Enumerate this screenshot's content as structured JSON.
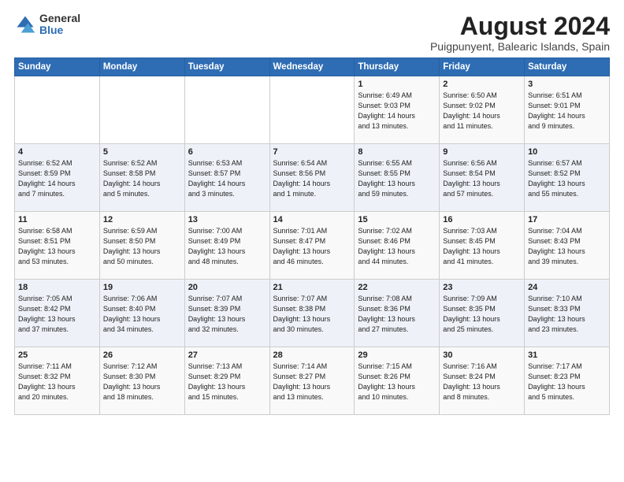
{
  "header": {
    "logo_general": "General",
    "logo_blue": "Blue",
    "title": "August 2024",
    "subtitle": "Puigpunyent, Balearic Islands, Spain"
  },
  "weekdays": [
    "Sunday",
    "Monday",
    "Tuesday",
    "Wednesday",
    "Thursday",
    "Friday",
    "Saturday"
  ],
  "weeks": [
    [
      {
        "day": "",
        "info": ""
      },
      {
        "day": "",
        "info": ""
      },
      {
        "day": "",
        "info": ""
      },
      {
        "day": "",
        "info": ""
      },
      {
        "day": "1",
        "info": "Sunrise: 6:49 AM\nSunset: 9:03 PM\nDaylight: 14 hours\nand 13 minutes."
      },
      {
        "day": "2",
        "info": "Sunrise: 6:50 AM\nSunset: 9:02 PM\nDaylight: 14 hours\nand 11 minutes."
      },
      {
        "day": "3",
        "info": "Sunrise: 6:51 AM\nSunset: 9:01 PM\nDaylight: 14 hours\nand 9 minutes."
      }
    ],
    [
      {
        "day": "4",
        "info": "Sunrise: 6:52 AM\nSunset: 8:59 PM\nDaylight: 14 hours\nand 7 minutes."
      },
      {
        "day": "5",
        "info": "Sunrise: 6:52 AM\nSunset: 8:58 PM\nDaylight: 14 hours\nand 5 minutes."
      },
      {
        "day": "6",
        "info": "Sunrise: 6:53 AM\nSunset: 8:57 PM\nDaylight: 14 hours\nand 3 minutes."
      },
      {
        "day": "7",
        "info": "Sunrise: 6:54 AM\nSunset: 8:56 PM\nDaylight: 14 hours\nand 1 minute."
      },
      {
        "day": "8",
        "info": "Sunrise: 6:55 AM\nSunset: 8:55 PM\nDaylight: 13 hours\nand 59 minutes."
      },
      {
        "day": "9",
        "info": "Sunrise: 6:56 AM\nSunset: 8:54 PM\nDaylight: 13 hours\nand 57 minutes."
      },
      {
        "day": "10",
        "info": "Sunrise: 6:57 AM\nSunset: 8:52 PM\nDaylight: 13 hours\nand 55 minutes."
      }
    ],
    [
      {
        "day": "11",
        "info": "Sunrise: 6:58 AM\nSunset: 8:51 PM\nDaylight: 13 hours\nand 53 minutes."
      },
      {
        "day": "12",
        "info": "Sunrise: 6:59 AM\nSunset: 8:50 PM\nDaylight: 13 hours\nand 50 minutes."
      },
      {
        "day": "13",
        "info": "Sunrise: 7:00 AM\nSunset: 8:49 PM\nDaylight: 13 hours\nand 48 minutes."
      },
      {
        "day": "14",
        "info": "Sunrise: 7:01 AM\nSunset: 8:47 PM\nDaylight: 13 hours\nand 46 minutes."
      },
      {
        "day": "15",
        "info": "Sunrise: 7:02 AM\nSunset: 8:46 PM\nDaylight: 13 hours\nand 44 minutes."
      },
      {
        "day": "16",
        "info": "Sunrise: 7:03 AM\nSunset: 8:45 PM\nDaylight: 13 hours\nand 41 minutes."
      },
      {
        "day": "17",
        "info": "Sunrise: 7:04 AM\nSunset: 8:43 PM\nDaylight: 13 hours\nand 39 minutes."
      }
    ],
    [
      {
        "day": "18",
        "info": "Sunrise: 7:05 AM\nSunset: 8:42 PM\nDaylight: 13 hours\nand 37 minutes."
      },
      {
        "day": "19",
        "info": "Sunrise: 7:06 AM\nSunset: 8:40 PM\nDaylight: 13 hours\nand 34 minutes."
      },
      {
        "day": "20",
        "info": "Sunrise: 7:07 AM\nSunset: 8:39 PM\nDaylight: 13 hours\nand 32 minutes."
      },
      {
        "day": "21",
        "info": "Sunrise: 7:07 AM\nSunset: 8:38 PM\nDaylight: 13 hours\nand 30 minutes."
      },
      {
        "day": "22",
        "info": "Sunrise: 7:08 AM\nSunset: 8:36 PM\nDaylight: 13 hours\nand 27 minutes."
      },
      {
        "day": "23",
        "info": "Sunrise: 7:09 AM\nSunset: 8:35 PM\nDaylight: 13 hours\nand 25 minutes."
      },
      {
        "day": "24",
        "info": "Sunrise: 7:10 AM\nSunset: 8:33 PM\nDaylight: 13 hours\nand 23 minutes."
      }
    ],
    [
      {
        "day": "25",
        "info": "Sunrise: 7:11 AM\nSunset: 8:32 PM\nDaylight: 13 hours\nand 20 minutes."
      },
      {
        "day": "26",
        "info": "Sunrise: 7:12 AM\nSunset: 8:30 PM\nDaylight: 13 hours\nand 18 minutes."
      },
      {
        "day": "27",
        "info": "Sunrise: 7:13 AM\nSunset: 8:29 PM\nDaylight: 13 hours\nand 15 minutes."
      },
      {
        "day": "28",
        "info": "Sunrise: 7:14 AM\nSunset: 8:27 PM\nDaylight: 13 hours\nand 13 minutes."
      },
      {
        "day": "29",
        "info": "Sunrise: 7:15 AM\nSunset: 8:26 PM\nDaylight: 13 hours\nand 10 minutes."
      },
      {
        "day": "30",
        "info": "Sunrise: 7:16 AM\nSunset: 8:24 PM\nDaylight: 13 hours\nand 8 minutes."
      },
      {
        "day": "31",
        "info": "Sunrise: 7:17 AM\nSunset: 8:23 PM\nDaylight: 13 hours\nand 5 minutes."
      }
    ]
  ]
}
